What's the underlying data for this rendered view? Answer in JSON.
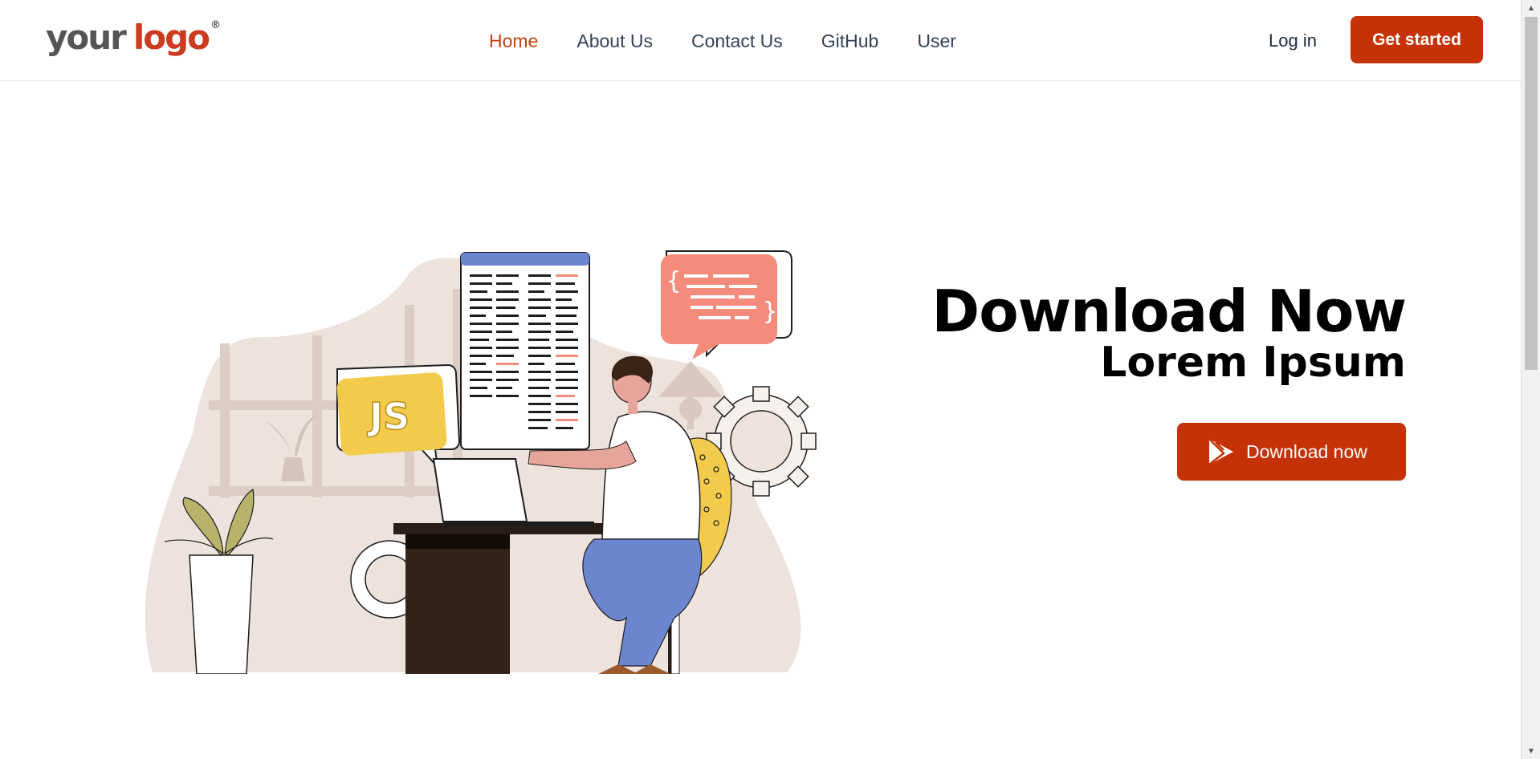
{
  "logo": {
    "word1": "your",
    "word2": "logo",
    "reg": "®"
  },
  "nav": {
    "items": [
      {
        "label": "Home",
        "active": true
      },
      {
        "label": "About Us"
      },
      {
        "label": "Contact Us"
      },
      {
        "label": "GitHub"
      },
      {
        "label": "User"
      }
    ]
  },
  "header": {
    "login_label": "Log in",
    "cta_label": "Get started"
  },
  "hero": {
    "title": "Download Now",
    "subtitle": "Lorem Ipsum",
    "button_label": "Download now",
    "illustration_badge": "JS",
    "code_bubble_symbols": "{ }"
  },
  "colors": {
    "accent": "#c53208",
    "nav_active": "#c2410c",
    "text": "#334155"
  },
  "icons": {
    "download_button_icon": "play-store-icon"
  }
}
